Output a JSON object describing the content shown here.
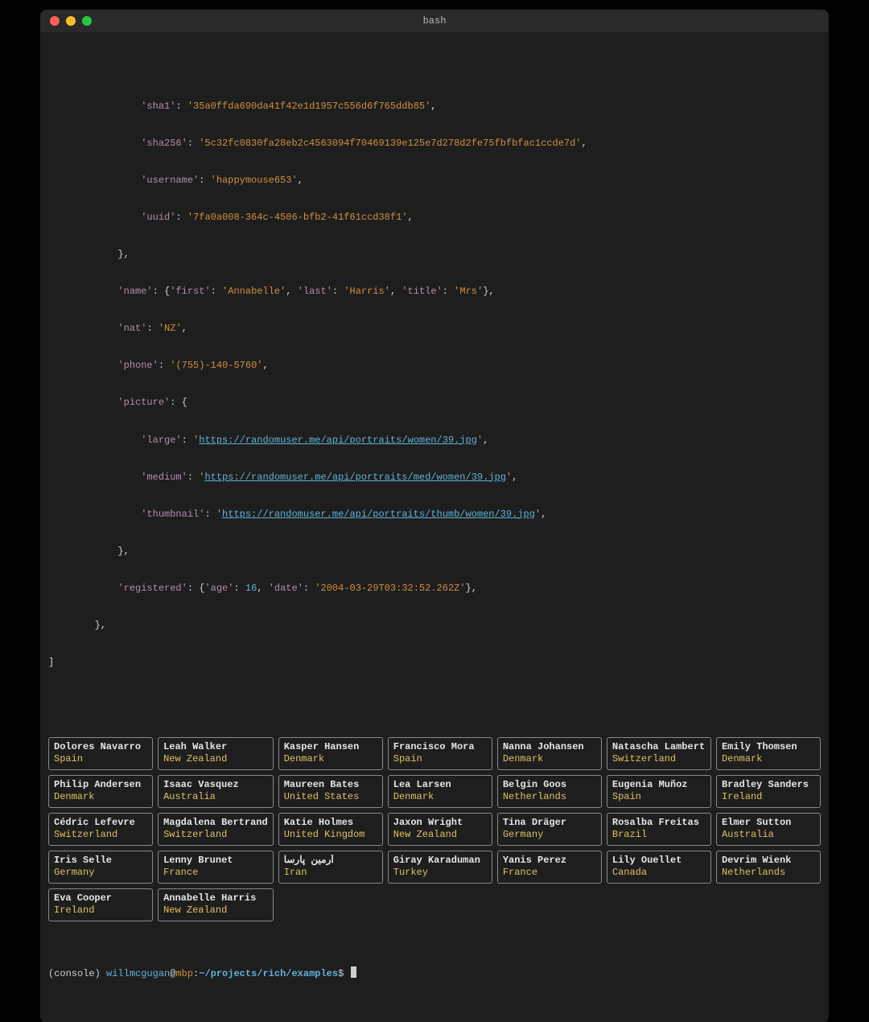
{
  "window": {
    "title": "bash"
  },
  "code": {
    "indent3": "            ",
    "indent2": "        ",
    "indent1": "    ",
    "indent0": "",
    "indent_pic": "                ",
    "sha1_key": "'sha1'",
    "sha1_val": "'35a0ffda690da41f42e1d1957c556d6f765ddb85'",
    "sha256_key": "'sha256'",
    "sha256_val": "'5c32fc0830fa28eb2c4563094f70469139e125e7d278d2fe75fbfbfac1ccde7d'",
    "username_key": "'username'",
    "username_val": "'happymouse653'",
    "uuid_key": "'uuid'",
    "uuid_val": "'7fa0a008-364c-4506-bfb2-41f61ccd38f1'",
    "closebrace1": "},",
    "name_key": "'name'",
    "name_first_k": "'first'",
    "name_first_v": "'Annabelle'",
    "name_last_k": "'last'",
    "name_last_v": "'Harris'",
    "name_title_k": "'title'",
    "name_title_v": "'Mrs'",
    "nat_key": "'nat'",
    "nat_val": "'NZ'",
    "phone_key": "'phone'",
    "phone_val": "'(755)-140-5760'",
    "picture_key": "'picture'",
    "large_key": "'large'",
    "large_url": "https://randomuser.me/api/portraits/women/39.jpg",
    "medium_key": "'medium'",
    "medium_url": "https://randomuser.me/api/portraits/med/women/39.jpg",
    "thumb_key": "'thumbnail'",
    "thumb_url": "https://randomuser.me/api/portraits/thumb/women/39.jpg",
    "registered_key": "'registered'",
    "age_k": "'age'",
    "age_v": "16",
    "date_k": "'date'",
    "date_v": "'2004-03-29T03:32:52.262Z'",
    "closebrace_outer": "},",
    "close_list": "]"
  },
  "cards": [
    [
      {
        "name": "Dolores Navarro",
        "country": "Spain"
      },
      {
        "name": "Leah Walker",
        "country": "New Zealand"
      },
      {
        "name": "Kasper Hansen",
        "country": "Denmark"
      },
      {
        "name": "Francisco Mora",
        "country": "Spain"
      },
      {
        "name": "Nanna Johansen",
        "country": "Denmark"
      },
      {
        "name": "Natascha Lambert",
        "country": "Switzerland"
      },
      {
        "name": "Emily Thomsen",
        "country": "Denmark"
      }
    ],
    [
      {
        "name": "Philip Andersen",
        "country": "Denmark"
      },
      {
        "name": "Isaac Vasquez",
        "country": "Australia"
      },
      {
        "name": "Maureen Bates",
        "country": "United States"
      },
      {
        "name": "Lea Larsen",
        "country": "Denmark"
      },
      {
        "name": "Belgin Goos",
        "country": "Netherlands"
      },
      {
        "name": "Eugenia Muñoz",
        "country": "Spain"
      },
      {
        "name": "Bradley Sanders",
        "country": "Ireland"
      }
    ],
    [
      {
        "name": "Cédric Lefevre",
        "country": "Switzerland"
      },
      {
        "name": "Magdalena Bertrand",
        "country": "Switzerland"
      },
      {
        "name": "Katie Holmes",
        "country": "United Kingdom"
      },
      {
        "name": "Jaxon Wright",
        "country": "New Zealand"
      },
      {
        "name": "Tina Dräger",
        "country": "Germany"
      },
      {
        "name": "Rosalba Freitas",
        "country": "Brazil"
      },
      {
        "name": "Elmer Sutton",
        "country": "Australia"
      }
    ],
    [
      {
        "name": "Iris Selle",
        "country": "Germany"
      },
      {
        "name": "Lenny Brunet",
        "country": "France"
      },
      {
        "name": "آرمین پارسا",
        "country": "Iran"
      },
      {
        "name": "Giray Karaduman",
        "country": "Turkey"
      },
      {
        "name": "Yanis Perez",
        "country": "France"
      },
      {
        "name": "Lily Ouellet",
        "country": "Canada"
      },
      {
        "name": "Devrim Wienk",
        "country": "Netherlands"
      }
    ],
    [
      {
        "name": "Eva Cooper",
        "country": "Ireland"
      },
      {
        "name": "Annabelle Harris",
        "country": "New Zealand"
      }
    ]
  ],
  "prompt": {
    "env_open": "(console) ",
    "user": "willmcgugan",
    "at": "@",
    "host": "mbp",
    "colon": ":",
    "path": "~/projects/rich/examples",
    "dollar": "$ "
  }
}
